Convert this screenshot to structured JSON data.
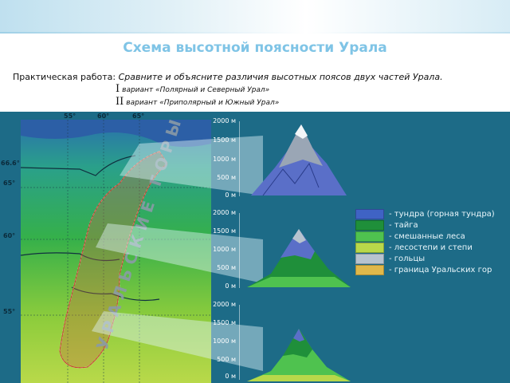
{
  "slide": {
    "title": "Схема высотной поясности Урала",
    "task_label": "Практическая работа:",
    "task_question": "Сравните и объясните различия высотных поясов двух частей Урала.",
    "variant1_num": "I",
    "variant1_text": "вариант «Полярный и Северный Урал»",
    "variant2_num": "II",
    "variant2_text": "вариант «Приполярный и Южный Урал»"
  },
  "map": {
    "mountain_label": "УРАЛЬСКИЕ ГОРЫ",
    "longitudes": [
      "55°",
      "60°",
      "65°"
    ],
    "latitudes": [
      "66.6°",
      "65°",
      "60°",
      "55°"
    ]
  },
  "profiles": [
    {
      "ticks": [
        "2000 м",
        "1500 м",
        "1000 м",
        "500 м",
        "0 м"
      ]
    },
    {
      "ticks": [
        "2000 м",
        "1500 м",
        "1000 м",
        "500 м",
        "0 м"
      ]
    },
    {
      "ticks": [
        "2000 м",
        "1500 м",
        "1000 м",
        "500 м",
        "0 м"
      ]
    }
  ],
  "legend": [
    {
      "label": "- тундра (горная тундра)",
      "color": "#3f63c4"
    },
    {
      "label": "- тайга",
      "color": "#1f8f3a"
    },
    {
      "label": "- смешанные леса",
      "color": "#4fc24f"
    },
    {
      "label": "- лесостепи и степи",
      "color": "#b8d84a"
    },
    {
      "label": "- гольцы",
      "color": "#b7c3cf"
    },
    {
      "label": "- граница Уральских гор",
      "color": "#e0b84a"
    }
  ]
}
